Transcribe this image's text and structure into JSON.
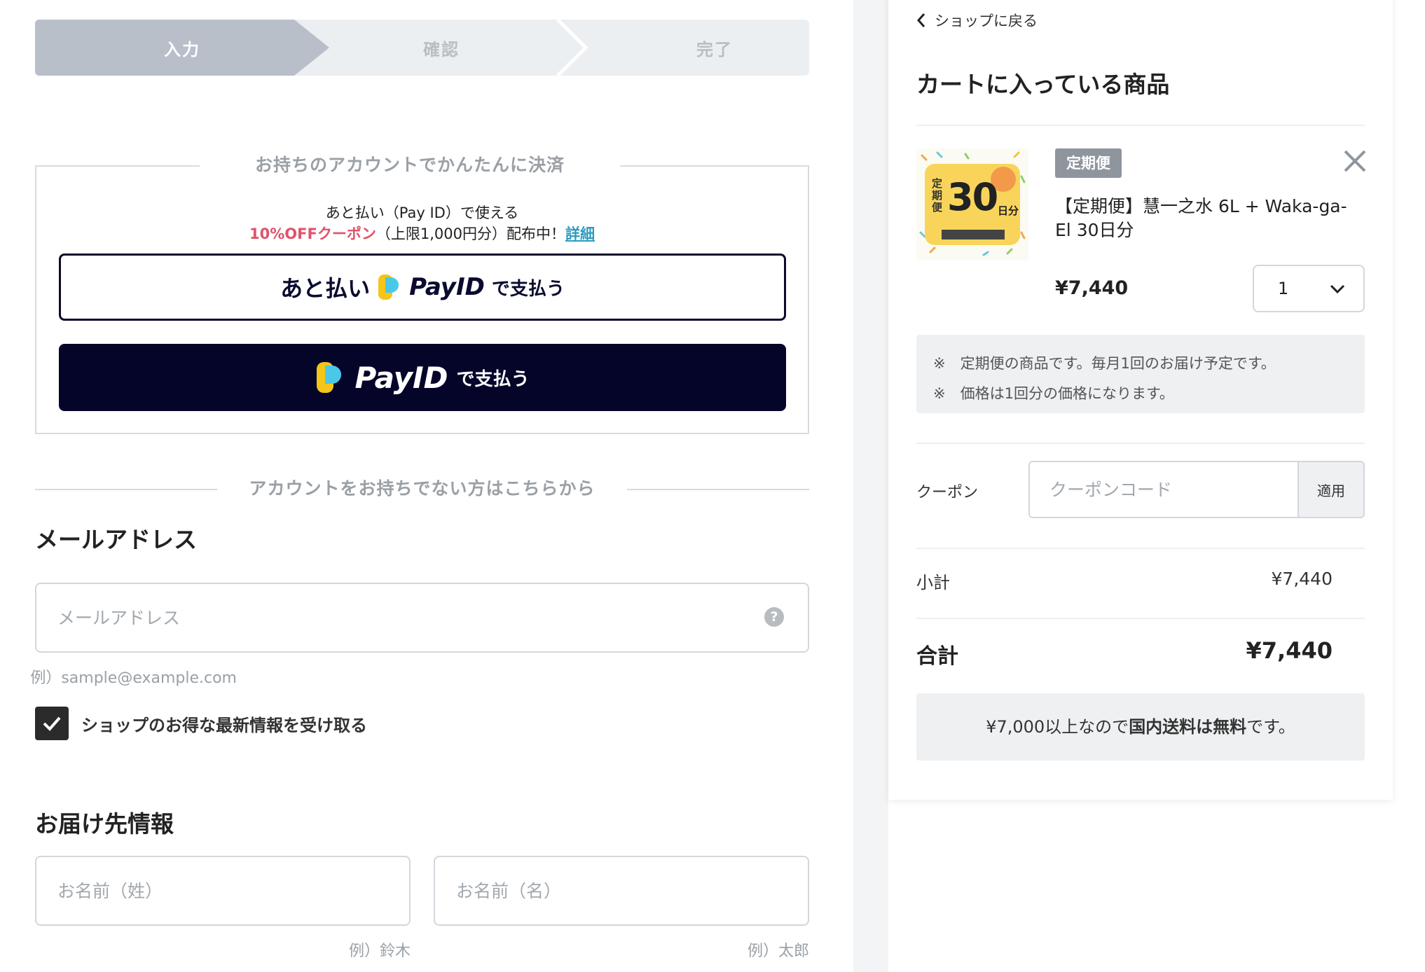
{
  "steps": [
    {
      "label": "入力"
    },
    {
      "label": "確認"
    },
    {
      "label": "完了"
    }
  ],
  "account_pay": {
    "legend": "お持ちのアカウントでかんたんに決済",
    "promo_line1": "あと払い（Pay ID）で使える",
    "promo_coupon": "10%OFFクーポン",
    "promo_rest": "（上限1,000円分）配布中！",
    "promo_link": "詳細",
    "pay_later": {
      "prefix": "あと払い",
      "brand": "PayID",
      "suffix": "で支払う"
    },
    "pay_now": {
      "brand": "PayID",
      "suffix": "で支払う"
    }
  },
  "guest_divider": "アカウントをお持ちでない方はこちらから",
  "email": {
    "title": "メールアドレス",
    "placeholder": "メールアドレス",
    "help": "?",
    "example": "例）sample@example.com"
  },
  "newsletter": {
    "label": "ショップのお得な最新情報を受け取る",
    "checked": true
  },
  "delivery": {
    "title": "お届け先情報",
    "last_name_placeholder": "お名前（姓）",
    "last_name_example": "例）鈴木",
    "first_name_placeholder": "お名前（名）",
    "first_name_example": "例）太郎"
  },
  "cart": {
    "back": "ショップに戻る",
    "title": "カートに入っている商品",
    "item": {
      "badge": "定期便",
      "name": "【定期便】慧一之水 6L + Waka-ga-El 30日分",
      "price": "¥7,440",
      "quantity": "1",
      "thumb_text": {
        "big": "30",
        "side": "定期便",
        "unit": "日分"
      }
    },
    "notes": [
      "※　定期便の商品です。毎月1回のお届け予定です。",
      "※　価格は1回分の価格になります。"
    ],
    "coupon": {
      "label": "クーポン",
      "placeholder": "クーポンコード",
      "apply": "適用"
    },
    "subtotal": {
      "label": "小計",
      "value": "¥7,440"
    },
    "total": {
      "label": "合計",
      "value": "¥7,440"
    },
    "shipping": {
      "pre": "¥7,000以上なので",
      "bold": "国内送料は無料",
      "post": "です。"
    }
  },
  "colors": {
    "accent_pink": "#e0526b",
    "link_blue": "#2c9bc0",
    "payid_navy": "#05052a",
    "step_active": "#b8bfc8"
  }
}
